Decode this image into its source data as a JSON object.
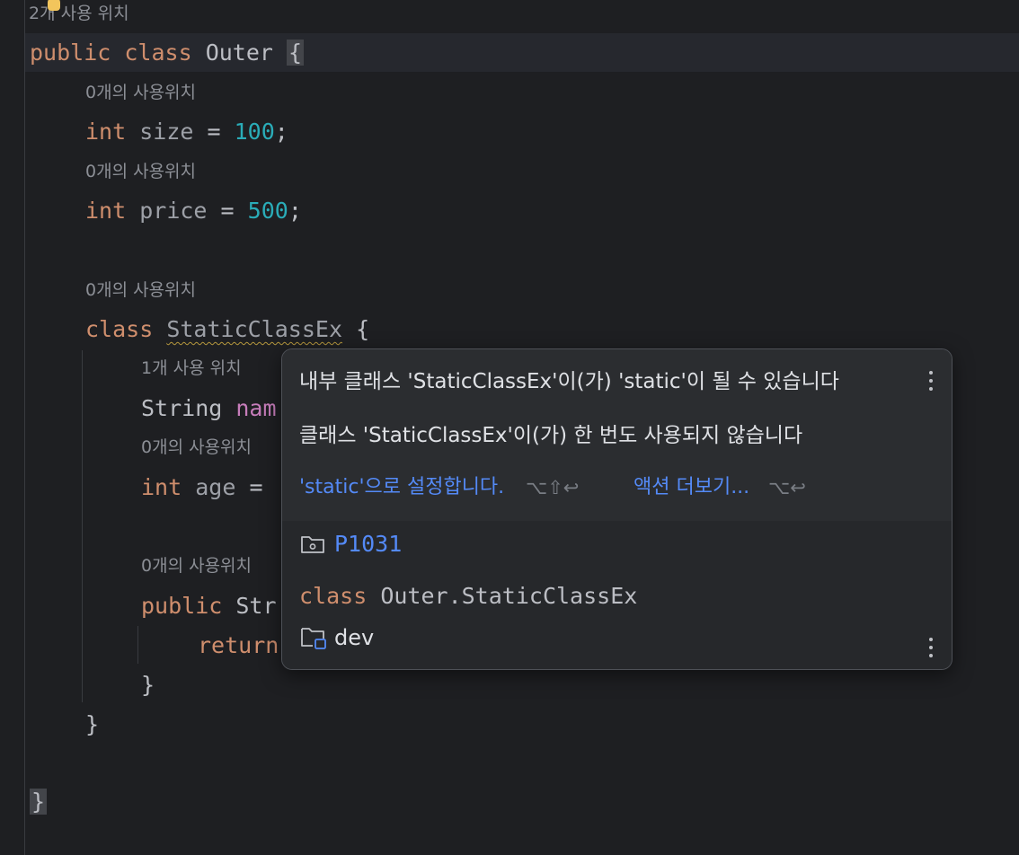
{
  "editor": {
    "hint_top": "2개 사용 위치",
    "line1": {
      "kw1": "public",
      "kw2": "class",
      "name": "Outer",
      "brace": "{"
    },
    "hint_size": "0개의 사용위치",
    "line_size": {
      "type": "int",
      "name": "size",
      "eq": "=",
      "value": "100",
      "semi": ";"
    },
    "hint_price": "0개의 사용위치",
    "line_price": {
      "type": "int",
      "name": "price",
      "eq": "=",
      "value": "500",
      "semi": ";"
    },
    "hint_class": "0개의 사용위치",
    "line_class": {
      "kw": "class",
      "name": "StaticClassEx",
      "brace": "{"
    },
    "hint_name": "1개 사용 위치",
    "line_name": {
      "type": "String",
      "name": "nam"
    },
    "hint_age": "0개의 사용위치",
    "line_age": {
      "type": "int",
      "name": "age",
      "eq": "="
    },
    "hint_method": "0개의 사용위치",
    "line_method": {
      "kw": "public",
      "type": "Str"
    },
    "line_return": {
      "kw": "return"
    },
    "close_inner_method": "}",
    "close_class": "}",
    "close_outer": "}"
  },
  "popup": {
    "message1": "내부 클래스 'StaticClassEx'이(가) 'static'이 될 수 있습니다",
    "message2": "클래스 'StaticClassEx'이(가) 한 번도 사용되지 않습니다",
    "action_static": "'static'으로 설정합니다.",
    "action_static_shortcut": "⌥⇧↩",
    "action_more": "액션 더보기...",
    "action_more_shortcut": "⌥↩",
    "module_name": "P1031",
    "class_kw": "class",
    "class_path": "Outer.StaticClassEx",
    "folder_name": "dev"
  },
  "colors": {
    "background": "#1e1f22",
    "keyword": "#cf8e6d",
    "number": "#2aacb8",
    "link": "#548af7",
    "warning_underline": "#b5973d"
  },
  "icons": [
    "lightbulb-icon",
    "kebab-menu-icon",
    "module-folder-icon",
    "source-folder-icon"
  ]
}
